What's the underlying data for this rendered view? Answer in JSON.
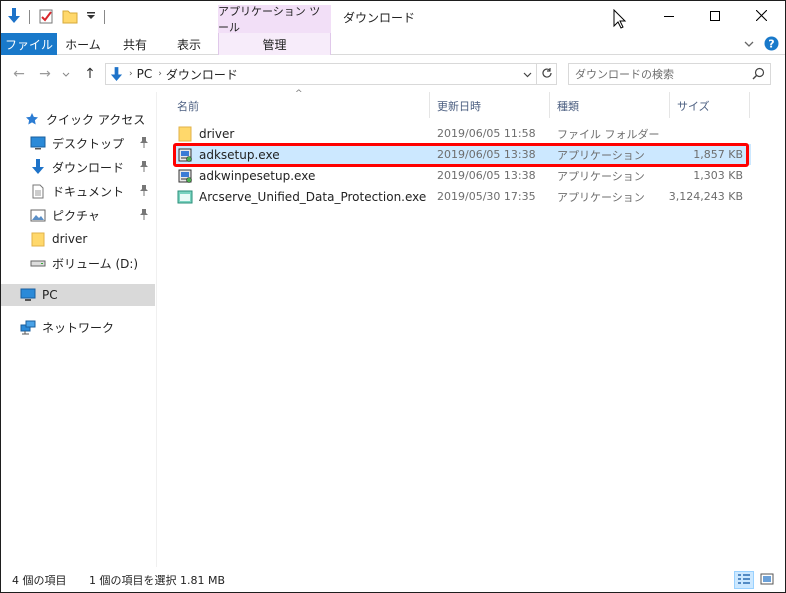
{
  "window": {
    "title": "ダウンロード",
    "context_tab_header": "アプリケーション ツール"
  },
  "ribbon": {
    "tabs": [
      {
        "label": "ファイル"
      },
      {
        "label": "ホーム"
      },
      {
        "label": "共有"
      },
      {
        "label": "表示"
      },
      {
        "label": "管理"
      }
    ]
  },
  "address": {
    "crumbs": [
      "PC",
      "ダウンロード"
    ],
    "search_placeholder": "ダウンロードの検索"
  },
  "nav": {
    "items": [
      {
        "label": "クイック アクセス",
        "icon": "star-icon",
        "pinned": false
      },
      {
        "label": "デスクトップ",
        "icon": "desktop-icon",
        "pinned": true
      },
      {
        "label": "ダウンロード",
        "icon": "download-arrow-icon",
        "pinned": true
      },
      {
        "label": "ドキュメント",
        "icon": "document-icon",
        "pinned": true
      },
      {
        "label": "ピクチャ",
        "icon": "pictures-icon",
        "pinned": true
      },
      {
        "label": "driver",
        "icon": "folder-icon",
        "pinned": false
      },
      {
        "label": "ボリューム (D:)",
        "icon": "drive-icon",
        "pinned": false
      },
      {
        "label": "PC",
        "icon": "pc-icon",
        "pinned": false,
        "selected": true
      },
      {
        "label": "ネットワーク",
        "icon": "network-icon",
        "pinned": false
      }
    ]
  },
  "columns": {
    "name": "名前",
    "date": "更新日時",
    "type": "種類",
    "size": "サイズ"
  },
  "files": [
    {
      "name": "driver",
      "date": "2019/06/05 11:58",
      "type": "ファイル フォルダー",
      "size": "",
      "icon": "folder-icon"
    },
    {
      "name": "adksetup.exe",
      "date": "2019/06/05 13:38",
      "type": "アプリケーション",
      "size": "1,857 KB",
      "icon": "installer-icon",
      "selected": true
    },
    {
      "name": "adkwinpesetup.exe",
      "date": "2019/06/05 13:38",
      "type": "アプリケーション",
      "size": "1,303 KB",
      "icon": "installer-icon"
    },
    {
      "name": "Arcserve_Unified_Data_Protection.exe",
      "date": "2019/05/30 17:35",
      "type": "アプリケーション",
      "size": "3,124,243 KB",
      "icon": "app-window-icon"
    }
  ],
  "status": {
    "count": "4 個の項目",
    "selection": "1 個の項目を選択  1.81 MB"
  },
  "colors": {
    "file_tab": "#1979ca",
    "context_tab": "#f2dff7",
    "selected_row": "#cce8ff",
    "highlight_border": "#ff0000"
  }
}
